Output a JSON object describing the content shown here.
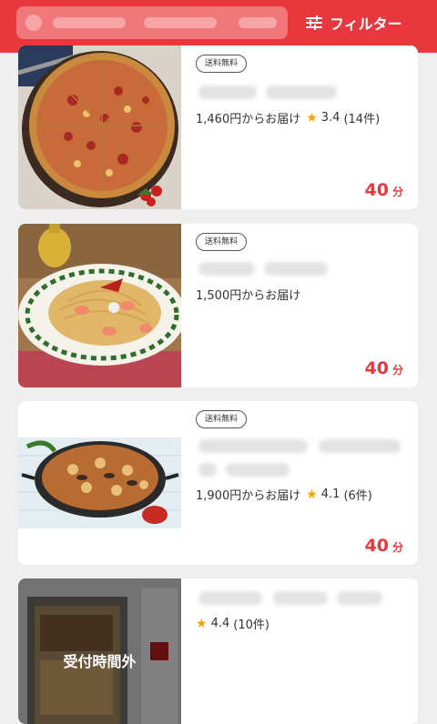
{
  "header": {
    "filter_label": "フィルター"
  },
  "cards": [
    {
      "badge": "送料無料",
      "price": "1,460円からお届け",
      "rating": "3.4",
      "reviews": "(14件)",
      "time": "40",
      "time_unit": "分"
    },
    {
      "badge": "送料無料",
      "price": "1,500円からお届け",
      "time": "40",
      "time_unit": "分"
    },
    {
      "badge": "送料無料",
      "price": "1,900円からお届け",
      "rating": "4.1",
      "reviews": "(6件)",
      "time": "40",
      "time_unit": "分"
    },
    {
      "rating": "4.4",
      "reviews": "(10件)",
      "closed_label": "受付時間外"
    }
  ],
  "colors": {
    "brand_red": "#e8383d",
    "star": "#f2a500"
  }
}
